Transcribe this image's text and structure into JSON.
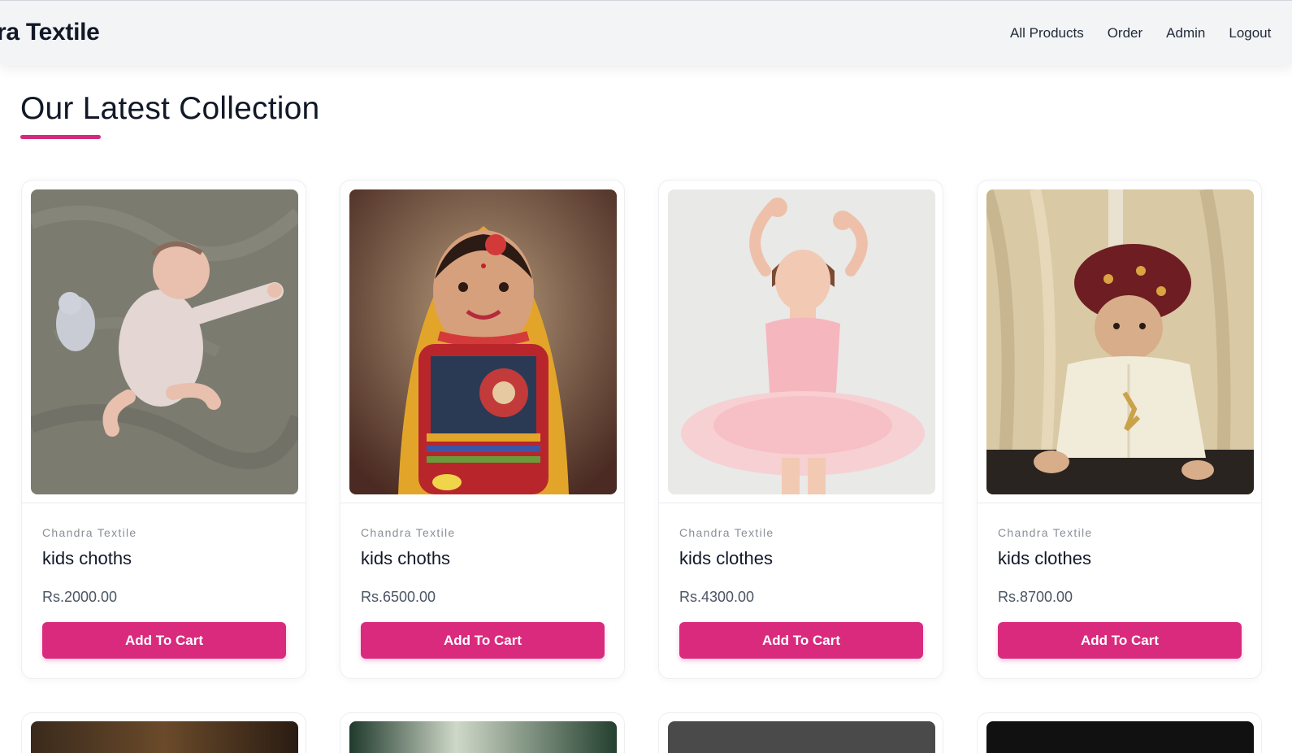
{
  "navbar": {
    "brand": "dra Textile",
    "links": [
      "All Products",
      "Order",
      "Admin",
      "Logout"
    ]
  },
  "section": {
    "title": "Our Latest Collection"
  },
  "products": [
    {
      "brand": "Chandra Textile",
      "name": "kids choths",
      "price": "Rs.2000.00",
      "button": "Add To Cart",
      "image": "baby-on-blanket"
    },
    {
      "brand": "Chandra Textile",
      "name": "kids choths",
      "price": "Rs.6500.00",
      "button": "Add To Cart",
      "image": "girl-traditional-dress"
    },
    {
      "brand": "Chandra Textile",
      "name": "kids clothes",
      "price": "Rs.4300.00",
      "button": "Add To Cart",
      "image": "girl-ballet-tutu"
    },
    {
      "brand": "Chandra Textile",
      "name": "kids clothes",
      "price": "Rs.8700.00",
      "button": "Add To Cart",
      "image": "boy-sherwani-turban"
    }
  ],
  "colors": {
    "accent": "#da2a7e",
    "navbar_bg": "#f3f4f6"
  }
}
